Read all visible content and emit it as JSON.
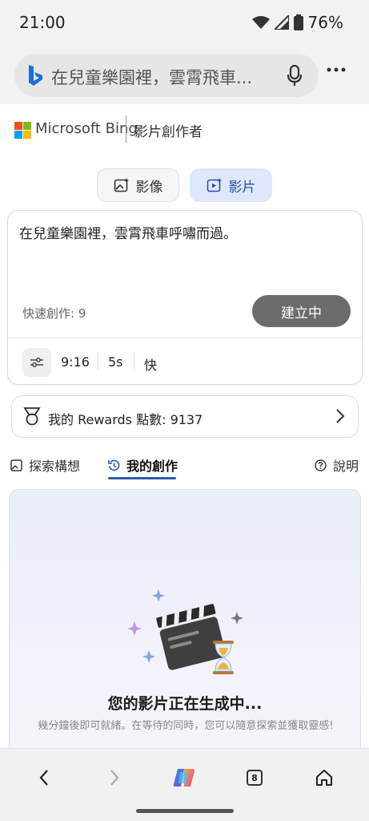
{
  "status_bar": {
    "time": "21:00",
    "battery": "76%"
  },
  "browser": {
    "url_text": "在兒童樂園裡，雲霄飛車..."
  },
  "header": {
    "brand": "Microsoft Bing",
    "product": "影片創作者"
  },
  "modes": [
    {
      "label": "影像",
      "icon": "image-sparkle-icon",
      "selected": false
    },
    {
      "label": "影片",
      "icon": "video-sparkle-icon",
      "selected": true
    }
  ],
  "prompt": {
    "text": "在兒童樂園裡，雲霄飛車呼嘯而過。",
    "quick_create": "快速創作: 9",
    "create_button": "建立中",
    "options": {
      "aspect": "9:16",
      "duration": "5s",
      "speed": "快"
    }
  },
  "rewards": {
    "text": "我的 Rewards 點數: 9137"
  },
  "tabs": [
    {
      "label": "探索構想",
      "icon": "image-icon",
      "active": false
    },
    {
      "label": "我的創作",
      "icon": "history-icon",
      "active": true
    }
  ],
  "help": {
    "label": "說明"
  },
  "generation": {
    "title": "您的影片正在生成中...",
    "subtitle": "幾分鐘後即可就緒。在等待的同時，您可以隨意探索並獲取靈感!"
  },
  "bottom_nav": {
    "tab_count": "8"
  },
  "colors": {
    "accent": "#2a5bb0",
    "create_button_bg": "#6b6c68",
    "video_tab_bg": "#dfe8fb"
  }
}
